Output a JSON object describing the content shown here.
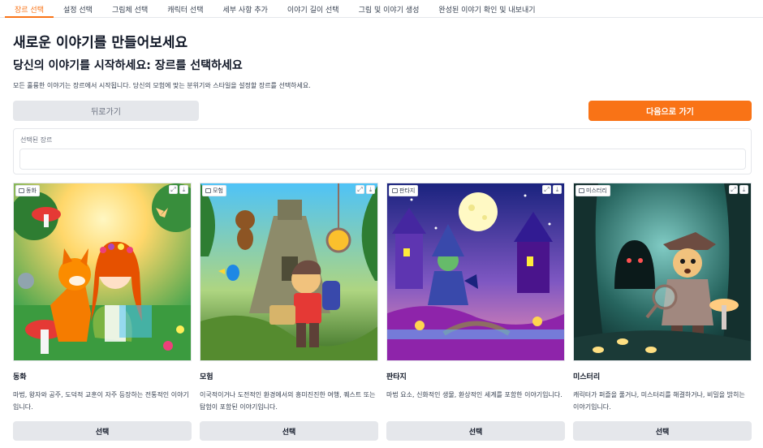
{
  "tabs": [
    {
      "label": "장르 선택",
      "active": true
    },
    {
      "label": "설정 선택",
      "active": false
    },
    {
      "label": "그림체 선택",
      "active": false
    },
    {
      "label": "캐릭터 선택",
      "active": false
    },
    {
      "label": "세부 사항 추가",
      "active": false
    },
    {
      "label": "이야기 길이 선택",
      "active": false
    },
    {
      "label": "그림 및 이야기 생성",
      "active": false
    },
    {
      "label": "완성된 이야기 확인 및 내보내기",
      "active": false
    }
  ],
  "header": {
    "title": "새로운 이야기를 만들어보세요",
    "subtitle": "당신의 이야기를 시작하세요: 장르를 선택하세요",
    "description": "모든 훌륭한 이야기는 장르에서 시작됩니다. 당신의 모험에 맞는 분위기와 스타일을 설정할 장르를 선택하세요."
  },
  "nav": {
    "back_label": "뒤로가기",
    "next_label": "다음으로 가기",
    "accent_color": "#f97316"
  },
  "selected_genre": {
    "label": "선택된 장르",
    "value": ""
  },
  "genres": [
    {
      "badge": "동화",
      "title": "동화",
      "description": "마법, 왕자와 공주, 도덕적 교훈이 자주 등장하는 전통적인 이야기입니다.",
      "button": "선택",
      "image_icon": "fairy-tale-illustration"
    },
    {
      "badge": "모험",
      "title": "모험",
      "description": "이국적이거나 도전적인 환경에서의 흥미진진한 여행, 퀘스트 또는 탐험이 포함된 이야기입니다.",
      "button": "선택",
      "image_icon": "adventure-illustration"
    },
    {
      "badge": "판타지",
      "title": "판타지",
      "description": "마법 요소, 신화적인 생물, 환상적인 세계를 포함한 이야기입니다.",
      "button": "선택",
      "image_icon": "fantasy-illustration"
    },
    {
      "badge": "미스터리",
      "title": "미스터리",
      "description": "캐릭터가 퍼즐을 풀거나, 미스터리를 해결하거나, 비밀을 밝히는 이야기입니다.",
      "button": "선택",
      "image_icon": "mystery-illustration"
    }
  ]
}
